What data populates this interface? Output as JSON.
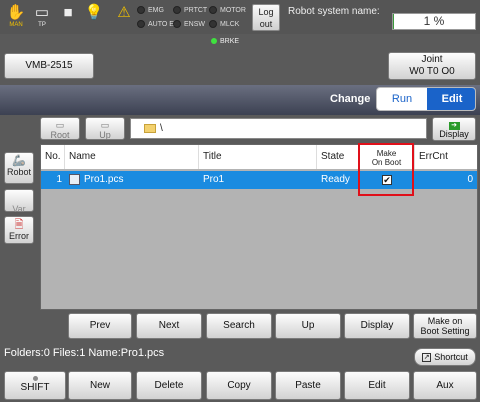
{
  "topbar": {
    "icons": [
      {
        "name": "hand-icon",
        "label": "MAN"
      },
      {
        "name": "teach-pendant-icon",
        "label": "TP"
      },
      {
        "name": "stop-icon",
        "label": ""
      },
      {
        "name": "lightbulb-icon",
        "label": ""
      },
      {
        "name": "warning-icon",
        "label": ""
      }
    ],
    "leds": [
      "EMG",
      "AUTO EN",
      "PRTCT",
      "ENSW",
      "MOTOR",
      "MLCK"
    ],
    "logout_label": "Log out",
    "system_name_label": "Robot system name:",
    "progress_text": "1 %",
    "progress_value": 1,
    "brake_label": "BRKE"
  },
  "robot_model": "VMB-2515",
  "joint": {
    "line1": "Joint",
    "line2": "W0 T0 O0"
  },
  "change_label": "Change",
  "mode": {
    "run": "Run",
    "edit": "Edit",
    "selected": "Edit"
  },
  "toolbar": {
    "root": "Root",
    "up": "Up",
    "path": "\\",
    "display": "Display"
  },
  "sidebar": {
    "robot": "Robot",
    "var": "Var",
    "error": "Error"
  },
  "table": {
    "headers": {
      "no": "No.",
      "name": "Name",
      "title": "Title",
      "state": "State",
      "make_on_boot_1": "Make",
      "make_on_boot_2": "On Boot",
      "errcnt": "ErrCnt"
    },
    "rows": [
      {
        "no": "1",
        "name": "Pro1.pcs",
        "title": "Pro1",
        "state": "Ready",
        "make_on_boot": true,
        "errcnt": "0"
      }
    ]
  },
  "nav": {
    "prev": "Prev",
    "next": "Next",
    "search": "Search",
    "up": "Up",
    "display": "Display",
    "make_line1": "Make on",
    "make_line2": "Boot Setting"
  },
  "status": "Folders:0  Files:1  Name:Pro1.pcs",
  "shortcut": "Shortcut",
  "bottom": {
    "shift": "SHIFT",
    "new": "New",
    "delete": "Delete",
    "copy": "Copy",
    "paste": "Paste",
    "edit": "Edit",
    "aux": "Aux"
  },
  "colors": {
    "accent": "#1a63c9",
    "selection": "#1a8be0",
    "highlight_box": "#e0101a",
    "brake_led": "#3fe23f"
  }
}
